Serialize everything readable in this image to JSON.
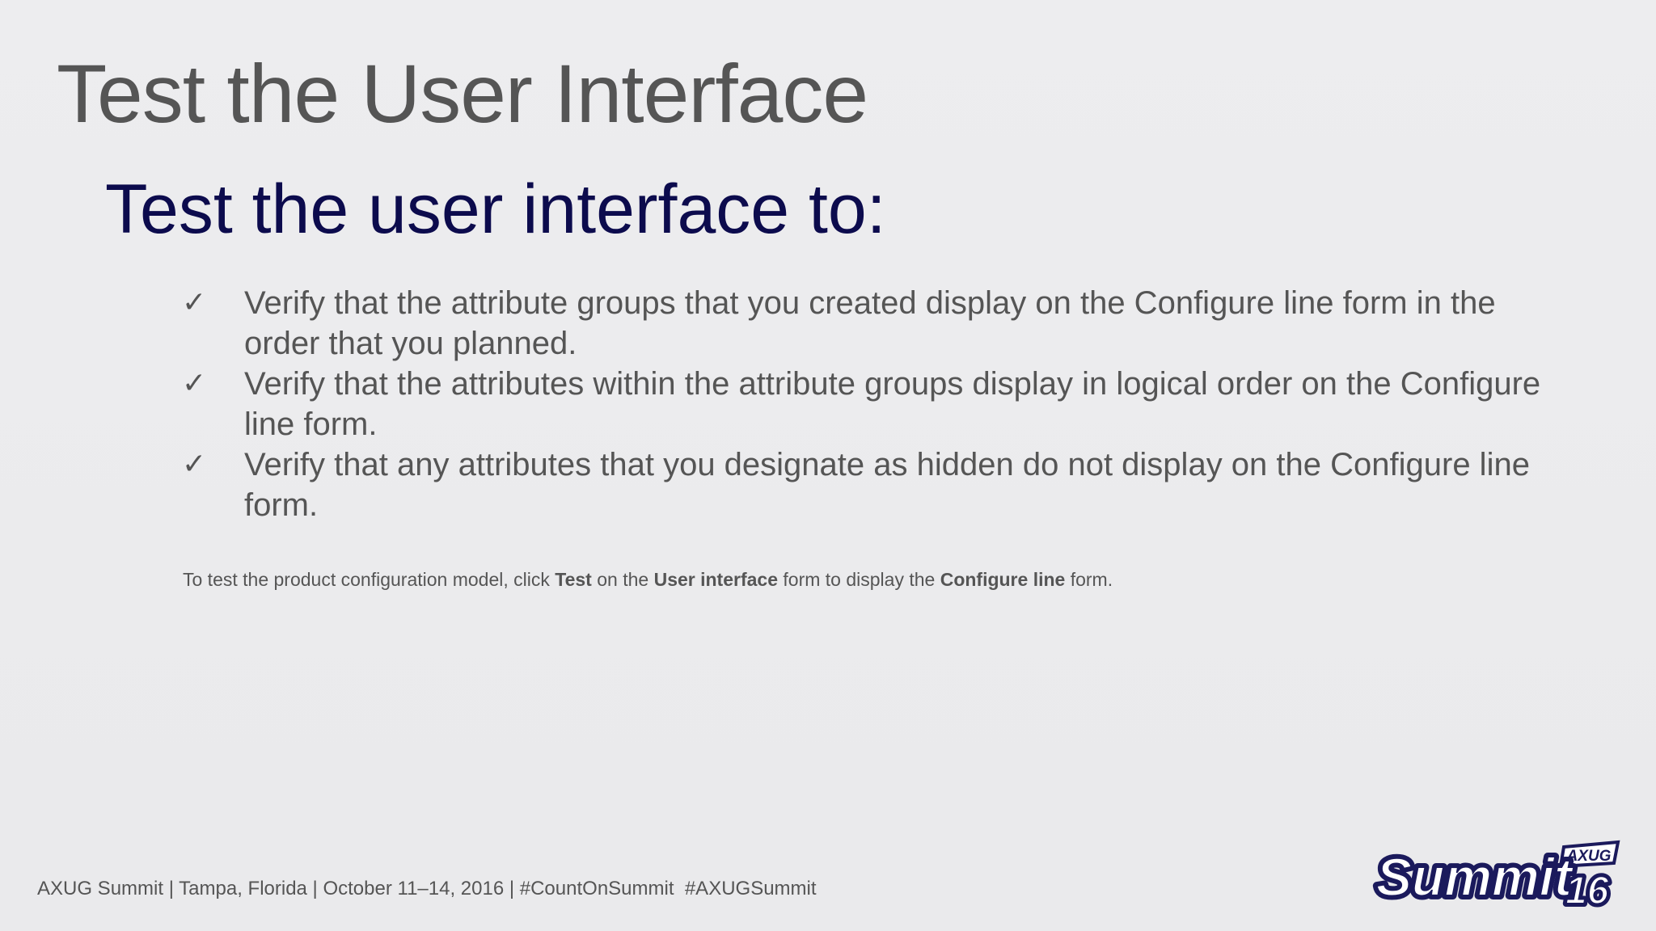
{
  "slide": {
    "title": "Test the User Interface",
    "subtitle": "Test the user interface to:",
    "bullets": [
      {
        "icon": "checkmark-icon",
        "text": "Verify that the attribute groups that you created display on the Configure line form in the order that you planned."
      },
      {
        "icon": "checkmark-icon",
        "text": "Verify that the attributes within the attribute groups display in logical order on the Configure line form."
      },
      {
        "icon": "checkmark-icon",
        "text": "Verify that any attributes that you designate as hidden do not display on the Configure line form."
      }
    ],
    "note": {
      "part1": "To test the product configuration model, click ",
      "bold1": "Test",
      "part2": " on the ",
      "bold2": "User interface",
      "part3": " form to display the ",
      "bold3": "Configure line",
      "part4": " form."
    },
    "footer": "AXUG Summit | Tampa, Florida | October 11–14, 2016 | #CountOnSummit  #AXUGSummit",
    "logo": {
      "word": "Summit",
      "badge": "AXUG",
      "year": "16"
    }
  },
  "colors": {
    "background": "#ebebed",
    "title": "#555555",
    "subtitle": "#0c0b4d",
    "body": "#555555",
    "logo_navy": "#1b1a5c"
  }
}
